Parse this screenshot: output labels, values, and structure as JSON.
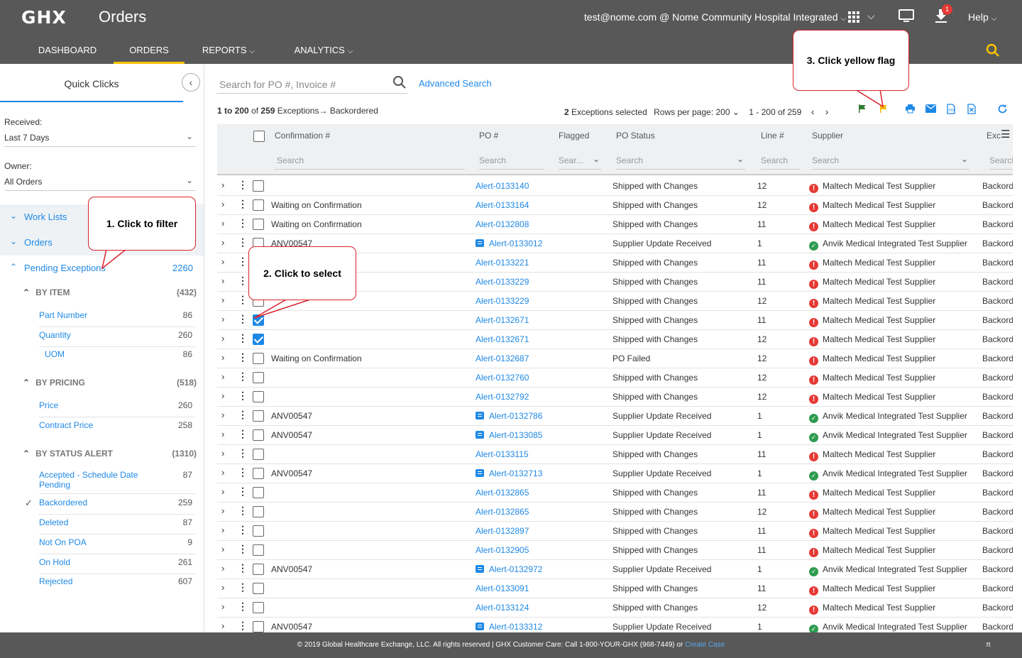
{
  "header": {
    "logo": "GHX",
    "title": "Orders",
    "user_email": "test@nome.com",
    "org": "Nome Community Hospital Integrated",
    "notification_count": "1",
    "help": "Help"
  },
  "nav": {
    "tabs": [
      {
        "label": "DASHBOARD",
        "active": false
      },
      {
        "label": "ORDERS",
        "active": true
      },
      {
        "label": "REPORTS",
        "active": false
      },
      {
        "label": "ANALYTICS",
        "active": false
      }
    ]
  },
  "sidebar": {
    "title": "Quick Clicks",
    "received_label": "Received:",
    "received_value": "Last 7 Days",
    "owner_label": "Owner:",
    "owner_value": "All Orders",
    "work_lists": "Work Lists",
    "orders": "Orders",
    "pending_exceptions": "Pending Exceptions",
    "pending_count": "2260",
    "groups": [
      {
        "label": "BY ITEM",
        "count": "(432)",
        "items": [
          {
            "label": "Part Number",
            "count": "86"
          },
          {
            "label": "Quantity",
            "count": "260"
          },
          {
            "label": "UOM",
            "count": "86"
          }
        ]
      },
      {
        "label": "BY PRICING",
        "count": "(518)",
        "items": [
          {
            "label": "Price",
            "count": "260"
          },
          {
            "label": "Contract Price",
            "count": "258"
          }
        ]
      },
      {
        "label": "BY STATUS ALERT",
        "count": "(1310)",
        "items": [
          {
            "label": "Accepted - Schedule Date Pending",
            "count": "87"
          },
          {
            "label": "Backordered",
            "count": "259",
            "checked": true
          },
          {
            "label": "Deleted",
            "count": "87"
          },
          {
            "label": "Not On POA",
            "count": "9"
          },
          {
            "label": "On Hold",
            "count": "261"
          },
          {
            "label": "Rejected",
            "count": "607"
          }
        ]
      }
    ]
  },
  "main": {
    "search_placeholder": "Search for PO #, Invoice #",
    "advanced_search": "Advanced Search",
    "summary_range": "1 to 200",
    "summary_of": "of",
    "summary_total": "259",
    "summary_exceptions": "Exceptions",
    "summary_filter": "Backordered",
    "selected_count": "2",
    "selected_label": "Exceptions selected",
    "rows_per_page_label": "Rows per page:",
    "rows_per_page": "200",
    "page_range": "1 - 200 of 259",
    "columns": {
      "confirmation": "Confirmation #",
      "po": "PO #",
      "flagged": "Flagged",
      "po_status": "PO Status",
      "line": "Line #",
      "supplier": "Supplier",
      "exception": "Exc"
    },
    "filters": {
      "confirmation": "Search",
      "po": "Search",
      "flagged": "Sear...",
      "po_status": "Search",
      "line": "Search",
      "supplier": "Search",
      "exception": "Search"
    },
    "rows": [
      {
        "conf": "",
        "po": "Alert-0133140",
        "msg": false,
        "status": "Shipped with Changes",
        "line": "12",
        "supplier": "Maltech Medical Test Supplier",
        "sup_ok": false,
        "exc": "Backord",
        "checked": false
      },
      {
        "conf": "Waiting on Confirmation",
        "po": "Alert-0133164",
        "msg": false,
        "status": "Shipped with Changes",
        "line": "12",
        "supplier": "Maltech Medical Test Supplier",
        "sup_ok": false,
        "exc": "Backord",
        "checked": false
      },
      {
        "conf": "Waiting on Confirmation",
        "po": "Alert-0132808",
        "msg": false,
        "status": "Shipped with Changes",
        "line": "11",
        "supplier": "Maltech Medical Test Supplier",
        "sup_ok": false,
        "exc": "Backord",
        "checked": false
      },
      {
        "conf": "ANV00547",
        "po": "Alert-0133012",
        "msg": true,
        "status": "Supplier Update Received",
        "line": "1",
        "supplier": "Anvik Medical Integrated Test Supplier",
        "sup_ok": true,
        "exc": "Backord",
        "checked": false
      },
      {
        "conf": "",
        "po": "Alert-0133221",
        "msg": false,
        "status": "Shipped with Changes",
        "line": "11",
        "supplier": "Maltech Medical Test Supplier",
        "sup_ok": false,
        "exc": "Backord",
        "checked": false
      },
      {
        "conf": "",
        "po": "Alert-0133229",
        "msg": false,
        "status": "Shipped with Changes",
        "line": "11",
        "supplier": "Maltech Medical Test Supplier",
        "sup_ok": false,
        "exc": "Backord",
        "checked": false
      },
      {
        "conf": "",
        "po": "Alert-0133229",
        "msg": false,
        "status": "Shipped with Changes",
        "line": "12",
        "supplier": "Maltech Medical Test Supplier",
        "sup_ok": false,
        "exc": "Backord",
        "checked": false
      },
      {
        "conf": "",
        "po": "Alert-0132671",
        "msg": false,
        "status": "Shipped with Changes",
        "line": "11",
        "supplier": "Maltech Medical Test Supplier",
        "sup_ok": false,
        "exc": "Backord",
        "checked": true
      },
      {
        "conf": "",
        "po": "Alert-0132671",
        "msg": false,
        "status": "Shipped with Changes",
        "line": "12",
        "supplier": "Maltech Medical Test Supplier",
        "sup_ok": false,
        "exc": "Backord",
        "checked": true
      },
      {
        "conf": "Waiting on Confirmation",
        "po": "Alert-0132687",
        "msg": false,
        "status": "PO Failed",
        "line": "12",
        "supplier": "Maltech Medical Test Supplier",
        "sup_ok": false,
        "exc": "Backord",
        "checked": false
      },
      {
        "conf": "",
        "po": "Alert-0132760",
        "msg": false,
        "status": "Shipped with Changes",
        "line": "12",
        "supplier": "Maltech Medical Test Supplier",
        "sup_ok": false,
        "exc": "Backord",
        "checked": false
      },
      {
        "conf": "",
        "po": "Alert-0132792",
        "msg": false,
        "status": "Shipped with Changes",
        "line": "12",
        "supplier": "Maltech Medical Test Supplier",
        "sup_ok": false,
        "exc": "Backord",
        "checked": false
      },
      {
        "conf": "ANV00547",
        "po": "Alert-0132786",
        "msg": true,
        "status": "Supplier Update Received",
        "line": "1",
        "supplier": "Anvik Medical Integrated Test Supplier",
        "sup_ok": true,
        "exc": "Backord",
        "checked": false
      },
      {
        "conf": "ANV00547",
        "po": "Alert-0133085",
        "msg": true,
        "status": "Supplier Update Received",
        "line": "1",
        "supplier": "Anvik Medical Integrated Test Supplier",
        "sup_ok": true,
        "exc": "Backord",
        "checked": false
      },
      {
        "conf": "",
        "po": "Alert-0133115",
        "msg": false,
        "status": "Shipped with Changes",
        "line": "11",
        "supplier": "Maltech Medical Test Supplier",
        "sup_ok": false,
        "exc": "Backord",
        "checked": false
      },
      {
        "conf": "ANV00547",
        "po": "Alert-0132713",
        "msg": true,
        "status": "Supplier Update Received",
        "line": "1",
        "supplier": "Anvik Medical Integrated Test Supplier",
        "sup_ok": true,
        "exc": "Backord",
        "checked": false
      },
      {
        "conf": "",
        "po": "Alert-0132865",
        "msg": false,
        "status": "Shipped with Changes",
        "line": "11",
        "supplier": "Maltech Medical Test Supplier",
        "sup_ok": false,
        "exc": "Backord",
        "checked": false
      },
      {
        "conf": "",
        "po": "Alert-0132865",
        "msg": false,
        "status": "Shipped with Changes",
        "line": "12",
        "supplier": "Maltech Medical Test Supplier",
        "sup_ok": false,
        "exc": "Backord",
        "checked": false
      },
      {
        "conf": "",
        "po": "Alert-0132897",
        "msg": false,
        "status": "Shipped with Changes",
        "line": "11",
        "supplier": "Maltech Medical Test Supplier",
        "sup_ok": false,
        "exc": "Backord",
        "checked": false
      },
      {
        "conf": "",
        "po": "Alert-0132905",
        "msg": false,
        "status": "Shipped with Changes",
        "line": "11",
        "supplier": "Maltech Medical Test Supplier",
        "sup_ok": false,
        "exc": "Backord",
        "checked": false
      },
      {
        "conf": "ANV00547",
        "po": "Alert-0132972",
        "msg": true,
        "status": "Supplier Update Received",
        "line": "1",
        "supplier": "Anvik Medical Integrated Test Supplier",
        "sup_ok": true,
        "exc": "Backord",
        "checked": false
      },
      {
        "conf": "",
        "po": "Alert-0133091",
        "msg": false,
        "status": "Shipped with Changes",
        "line": "11",
        "supplier": "Maltech Medical Test Supplier",
        "sup_ok": false,
        "exc": "Backord",
        "checked": false
      },
      {
        "conf": "",
        "po": "Alert-0133124",
        "msg": false,
        "status": "Shipped with Changes",
        "line": "12",
        "supplier": "Maltech Medical Test Supplier",
        "sup_ok": false,
        "exc": "Backord",
        "checked": false
      },
      {
        "conf": "ANV00547",
        "po": "Alert-0133312",
        "msg": true,
        "status": "Supplier Update Received",
        "line": "1",
        "supplier": "Anvik Medical Integrated Test Supplier",
        "sup_ok": true,
        "exc": "Backord",
        "checked": false
      }
    ]
  },
  "callouts": {
    "c1": "1.  Click to filter",
    "c2": "2.  Click to select",
    "c3": "3. Click yellow flag"
  },
  "footer": {
    "text": "© 2019 Global Healthcare Exchange, LLC. All rights reserved | GHX Customer Care: Call 1-800-YOUR-GHX (968-7449) or",
    "link": "Create Case",
    "mark": "π"
  },
  "colors": {
    "topbar": "#585858",
    "accent": "#1e88e5",
    "active_tab": "#f7c500",
    "callout_border": "#d9232d"
  }
}
